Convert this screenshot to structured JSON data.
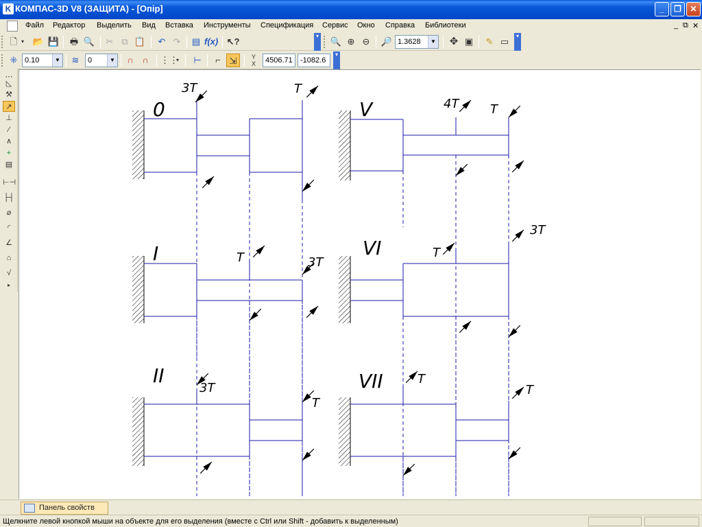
{
  "window": {
    "title": "КОМПАС-3D V8 (ЗАЩИТА) - [Опір]",
    "minimize": "_",
    "maximize": "❐",
    "close": "✕"
  },
  "menu": {
    "items": [
      "Файл",
      "Редактор",
      "Выделить",
      "Вид",
      "Вставка",
      "Инструменты",
      "Спецификация",
      "Сервис",
      "Окно",
      "Справка",
      "Библиотеки"
    ],
    "mdi_minimize": "_",
    "mdi_restore": "⧉",
    "mdi_close": "✕"
  },
  "toolbar_zoom": {
    "zoom_value": "1.3628"
  },
  "toolbar_current": {
    "step_value": "0.10",
    "layer_value": "0",
    "x_coord": "4506.71",
    "y_coord": "-1082.6"
  },
  "drawing": {
    "labels": [
      "0",
      "I",
      "II",
      "V",
      "VI",
      "VII"
    ],
    "annotations": [
      "3T",
      "T",
      "T",
      "3T",
      "3T",
      "T",
      "4T",
      "T",
      "3T",
      "T",
      "T",
      "T"
    ]
  },
  "panel": {
    "tab_label": "Панель свойств"
  },
  "status": {
    "text": "Щелкните левой кнопкой мыши на объекте для его выделения (вместе с Ctrl или Shift - добавить к выделенным)"
  }
}
